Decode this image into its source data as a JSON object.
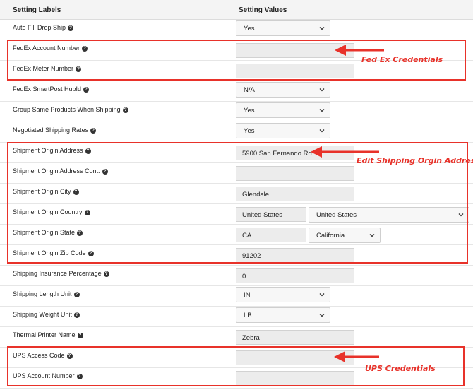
{
  "header": {
    "label_col": "Setting Labels",
    "value_col": "Setting Values"
  },
  "rows": [
    {
      "label": "Auto Fill Drop Ship",
      "type": "select",
      "value": "Yes"
    },
    {
      "label": "FedEx Account Number",
      "type": "input",
      "value": ""
    },
    {
      "label": "FedEx Meter Number",
      "type": "input",
      "value": ""
    },
    {
      "label": "FedEx SmartPost HubId",
      "type": "select",
      "value": "N/A"
    },
    {
      "label": "Group Same Products When Shipping",
      "type": "select",
      "value": "Yes"
    },
    {
      "label": "Negotiated Shipping Rates",
      "type": "select",
      "value": "Yes"
    },
    {
      "label": "Shipment Origin Address",
      "type": "input",
      "value": "5900 San Fernando Rd"
    },
    {
      "label": "Shipment Origin Address Cont.",
      "type": "input",
      "value": ""
    },
    {
      "label": "Shipment Origin City",
      "type": "input",
      "value": "Glendale"
    },
    {
      "label": "Shipment Origin Country",
      "type": "input_select",
      "value": "United States",
      "select_value": "United States"
    },
    {
      "label": "Shipment Origin State",
      "type": "input_select",
      "value": "CA",
      "select_value": "California"
    },
    {
      "label": "Shipment Origin Zip Code",
      "type": "input",
      "value": "91202"
    },
    {
      "label": "Shipping Insurance Percentage",
      "type": "input",
      "value": "0"
    },
    {
      "label": "Shipping Length Unit",
      "type": "select",
      "value": "IN"
    },
    {
      "label": "Shipping Weight Unit",
      "type": "select",
      "value": "LB"
    },
    {
      "label": "Thermal Printer Name",
      "type": "input",
      "value": "Zebra"
    },
    {
      "label": "UPS Access Code",
      "type": "input",
      "value": ""
    },
    {
      "label": "UPS Account Number",
      "type": "input",
      "value": ""
    }
  ],
  "help_glyph": "?",
  "annotations": {
    "fedex": "Fed Ex Credentials",
    "shipping": "Edit Shipping Orgin Address",
    "ups": "UPS Credentials",
    "color": "#e8322a"
  },
  "icons": {
    "help": "question-circle-icon",
    "dropdown": "chevron-down-icon",
    "arrow": "red-arrow-left-icon"
  }
}
